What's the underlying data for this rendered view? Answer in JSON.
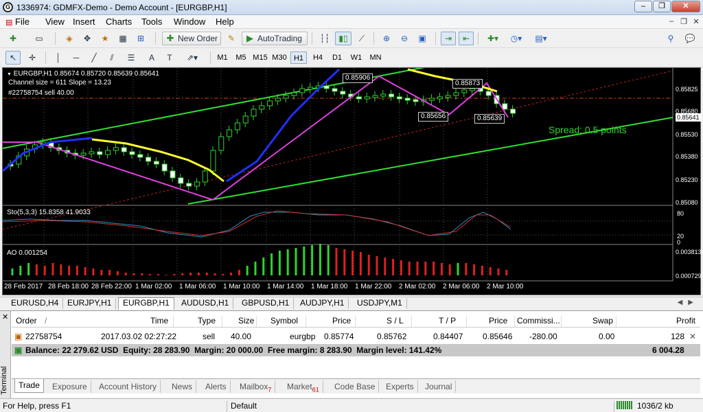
{
  "window": {
    "title": "1336974: GDMFX-Demo - Demo Account - [EURGBP,H1]",
    "app_icon": "mt4-icon",
    "min": "–",
    "max": "❐",
    "close": "✕"
  },
  "menu": {
    "items": [
      "File",
      "View",
      "Insert",
      "Charts",
      "Tools",
      "Window",
      "Help"
    ],
    "mdi_min": "–",
    "mdi_restore": "❐",
    "mdi_close": "✕"
  },
  "toolbar": {
    "new_order": "New Order",
    "auto_trading": "AutoTrading"
  },
  "timeframes": [
    "M1",
    "M5",
    "M15",
    "M30",
    "H1",
    "H4",
    "D1",
    "W1",
    "MN"
  ],
  "active_timeframe": "H1",
  "chart": {
    "header": "EURGBP,H1  0.85674 0.85720 0.85639 0.85641",
    "channel_info": "Channel size = 611 Slope = 13.23",
    "order_line": "#22758754 sell 40.00",
    "spread": "Spread: 0.5 points",
    "current_price": "0.85641",
    "price_labels": [
      "0.85906",
      "0.85873",
      "0.85656",
      "0.85639"
    ],
    "price_axis": [
      "0.85825",
      "0.85680",
      "0.85530",
      "0.85380",
      "0.85230",
      "0.85080"
    ],
    "stoch_label": "Sto(5,3,3) 15.8358 41.9033",
    "stoch_axis": [
      "80",
      "20",
      "0"
    ],
    "ao_label": "AO 0.001254",
    "ao_axis": [
      "0.003813",
      "0.000729"
    ],
    "time_axis": [
      "28 Feb 2017",
      "28 Feb 18:00",
      "28 Feb 22:00",
      "1 Mar 02:00",
      "1 Mar 06:00",
      "1 Mar 10:00",
      "1 Mar 14:00",
      "1 Mar 18:00",
      "1 Mar 22:00",
      "2 Mar 02:00",
      "2 Mar 06:00",
      "2 Mar 10:00"
    ],
    "colors": {
      "bg": "#000000",
      "candles": "#2fd52f",
      "channel": "#30e030",
      "zigzag": "#e040e0",
      "ma_yellow": "#ffff30",
      "ma_blue": "#2030ff",
      "ao_up": "#2fd52f",
      "ao_down": "#e02020"
    }
  },
  "chart_tabs": [
    "EURUSD,H4",
    "EURJPY,H1",
    "EURGBP,H1",
    "AUDUSD,H1",
    "GBPUSD,H1",
    "AUDJPY,H1",
    "USDJPY,M1"
  ],
  "active_chart_tab": "EURGBP,H1",
  "terminal": {
    "side_label": "Terminal",
    "columns": [
      "Order",
      "/",
      "Time",
      "Type",
      "Size",
      "Symbol",
      "Price",
      "S / L",
      "T / P",
      "Price",
      "Commissi...",
      "Swap",
      "Profit"
    ],
    "order": {
      "id": "22758754",
      "time": "2017.03.02 02:27:22",
      "type": "sell",
      "size": "40.00",
      "symbol": "eurgbp",
      "price": "0.85774",
      "sl": "0.85762",
      "tp": "0.84407",
      "cur_price": "0.85646",
      "commission": "-280.00",
      "swap": "0.00",
      "profit": "128"
    },
    "balance": "Balance: 22 279.62 USD  Equity: 28 283.90  Margin: 20 000.00  Free margin: 8 283.90  Margin level: 141.42%",
    "balance_profit": "6 004.28",
    "tabs": [
      {
        "label": "Trade",
        "badge": ""
      },
      {
        "label": "Exposure",
        "badge": ""
      },
      {
        "label": "Account History",
        "badge": ""
      },
      {
        "label": "News",
        "badge": ""
      },
      {
        "label": "Alerts",
        "badge": ""
      },
      {
        "label": "Mailbox",
        "badge": "7"
      },
      {
        "label": "Market",
        "badge": "61"
      },
      {
        "label": "Code Base",
        "badge": ""
      },
      {
        "label": "Experts",
        "badge": ""
      },
      {
        "label": "Journal",
        "badge": ""
      }
    ]
  },
  "status": {
    "help": "For Help, press F1",
    "profile": "Default",
    "traffic": "1036/2 kb"
  }
}
